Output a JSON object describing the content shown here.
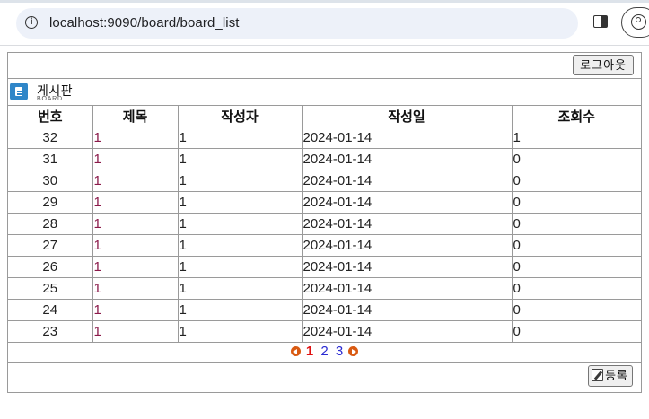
{
  "browser": {
    "url": "localhost:9090/board/board_list"
  },
  "toolbar": {
    "logout_label": "로그아웃"
  },
  "board_header": {
    "title": "게시판",
    "subtitle": "BOARD",
    "icon": "document-icon"
  },
  "table": {
    "headers": [
      "번호",
      "제목",
      "작성자",
      "작성일",
      "조회수"
    ],
    "rows": [
      {
        "no": "32",
        "title": "1",
        "writer": "1",
        "date": "2024-01-14",
        "views": "1"
      },
      {
        "no": "31",
        "title": "1",
        "writer": "1",
        "date": "2024-01-14",
        "views": "0"
      },
      {
        "no": "30",
        "title": "1",
        "writer": "1",
        "date": "2024-01-14",
        "views": "0"
      },
      {
        "no": "29",
        "title": "1",
        "writer": "1",
        "date": "2024-01-14",
        "views": "0"
      },
      {
        "no": "28",
        "title": "1",
        "writer": "1",
        "date": "2024-01-14",
        "views": "0"
      },
      {
        "no": "27",
        "title": "1",
        "writer": "1",
        "date": "2024-01-14",
        "views": "0"
      },
      {
        "no": "26",
        "title": "1",
        "writer": "1",
        "date": "2024-01-14",
        "views": "0"
      },
      {
        "no": "25",
        "title": "1",
        "writer": "1",
        "date": "2024-01-14",
        "views": "0"
      },
      {
        "no": "24",
        "title": "1",
        "writer": "1",
        "date": "2024-01-14",
        "views": "0"
      },
      {
        "no": "23",
        "title": "1",
        "writer": "1",
        "date": "2024-01-14",
        "views": "0"
      }
    ]
  },
  "pagination": {
    "pages": [
      "1",
      "2",
      "3"
    ],
    "current": "1"
  },
  "actions": {
    "write_label": "등록"
  },
  "colors": {
    "accent_icon": "#2f86c8",
    "title_link": "#8b1a4a",
    "current_page": "#e01010",
    "page_link": "#2a2ad2",
    "pager_arrow": "#d95a12"
  }
}
